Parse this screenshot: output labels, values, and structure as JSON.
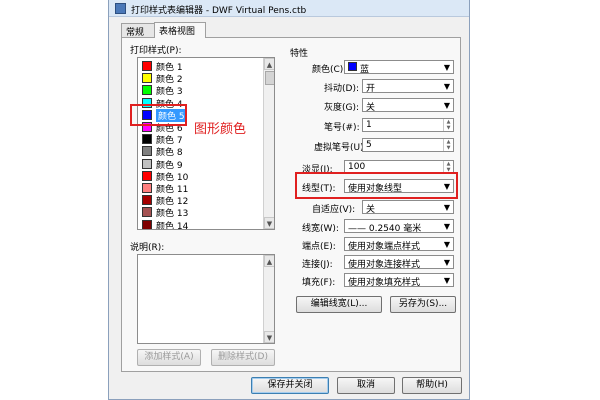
{
  "window": {
    "title": "打印样式表编辑器 - DWF Virtual Pens.ctb"
  },
  "tabs": [
    {
      "label": "常规",
      "active": false
    },
    {
      "label": "表格视图",
      "active": true
    }
  ],
  "left": {
    "print_styles_label": "打印样式(P):",
    "styles": [
      {
        "label": "颜色 1",
        "color": "#ff0000"
      },
      {
        "label": "颜色 2",
        "color": "#ffff00"
      },
      {
        "label": "颜色 3",
        "color": "#00ff00"
      },
      {
        "label": "颜色 4",
        "color": "#00ffff"
      },
      {
        "label": "颜色 5",
        "color": "#0000ff",
        "selected": true
      },
      {
        "label": "颜色 6",
        "color": "#ff00ff"
      },
      {
        "label": "颜色 7",
        "color": "#000000"
      },
      {
        "label": "颜色 8",
        "color": "#808080"
      },
      {
        "label": "颜色 9",
        "color": "#c0c0c0"
      },
      {
        "label": "颜色 10",
        "color": "#ff0000"
      },
      {
        "label": "颜色 11",
        "color": "#ff7f7f"
      },
      {
        "label": "颜色 12",
        "color": "#a50000"
      },
      {
        "label": "颜色 13",
        "color": "#a55252"
      },
      {
        "label": "颜色 14",
        "color": "#7f0000"
      }
    ],
    "description_label": "说明(R):",
    "add_style_button": "添加样式(A)",
    "delete_style_button": "删除样式(D)"
  },
  "annotation": {
    "text": "图形颜色",
    "color": "#e02020"
  },
  "properties": {
    "group_label": "特性",
    "color_label": "颜色(C):",
    "color_value": "蓝",
    "color_swatch": "#0000ff",
    "dither_label": "抖动(D):",
    "dither_value": "开",
    "grayscale_label": "灰度(G):",
    "grayscale_value": "关",
    "pen_label": "笔号(#):",
    "pen_value": "1",
    "virtual_pen_label": "虚拟笔号(U):",
    "virtual_pen_value": "5",
    "screening_label": "淡显(I):",
    "screening_value": "100",
    "linetype_label": "线型(T):",
    "linetype_value": "使用对象线型",
    "adaptive_label": "自适应(V):",
    "adaptive_value": "关",
    "lineweight_label": "线宽(W):",
    "lineweight_value": "—— 0.2540 毫米",
    "endstyle_label": "端点(E):",
    "endstyle_value": "使用对象端点样式",
    "joinstyle_label": "连接(J):",
    "joinstyle_value": "使用对象连接样式",
    "fillstyle_label": "填充(F):",
    "fillstyle_value": "使用对象填充样式",
    "edit_lineweights_button": "编辑线宽(L)...",
    "save_as_button": "另存为(S)..."
  },
  "footer": {
    "save_close_button": "保存并关闭",
    "cancel_button": "取消",
    "help_button": "帮助(H)"
  }
}
